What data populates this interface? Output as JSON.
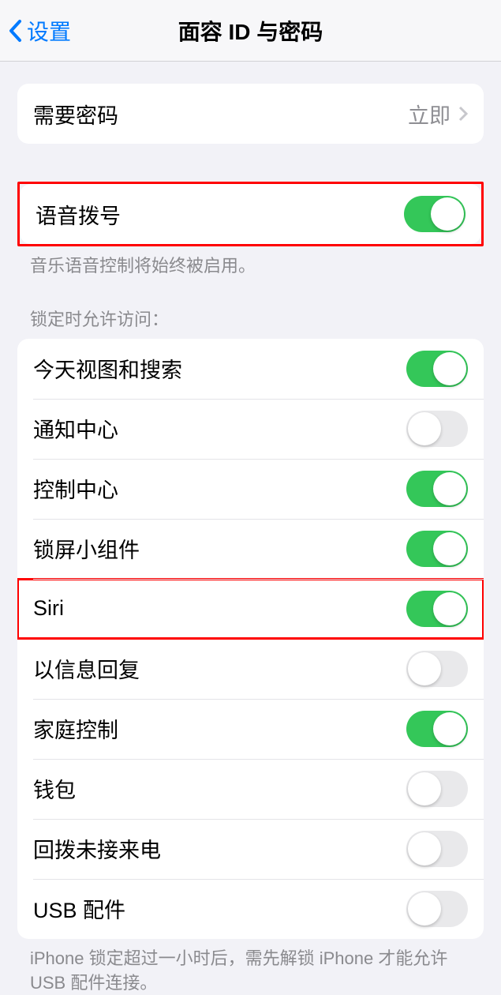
{
  "nav": {
    "back": "设置",
    "title": "面容 ID 与密码"
  },
  "require_passcode": {
    "label": "需要密码",
    "value": "立即"
  },
  "voice_dial": {
    "label": "语音拨号",
    "footer": "音乐语音控制将始终被启用。"
  },
  "lock_access": {
    "header": "锁定时允许访问：",
    "items": [
      {
        "label": "今天视图和搜索",
        "on": true
      },
      {
        "label": "通知中心",
        "on": false
      },
      {
        "label": "控制中心",
        "on": true
      },
      {
        "label": "锁屏小组件",
        "on": true
      },
      {
        "label": "Siri",
        "on": true
      },
      {
        "label": "以信息回复",
        "on": false
      },
      {
        "label": "家庭控制",
        "on": true
      },
      {
        "label": "钱包",
        "on": false
      },
      {
        "label": "回拨未接来电",
        "on": false
      },
      {
        "label": "USB 配件",
        "on": false
      }
    ],
    "footer": "iPhone 锁定超过一小时后，需先解锁 iPhone 才能允许 USB 配件连接。"
  }
}
